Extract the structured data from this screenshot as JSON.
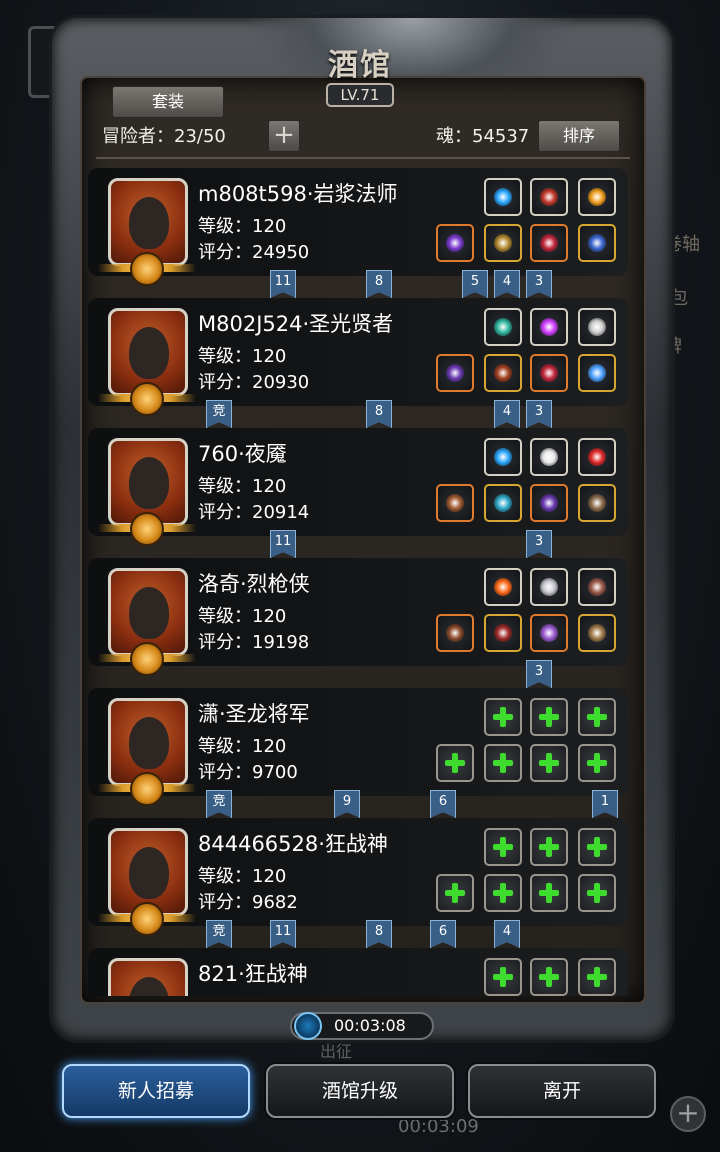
{
  "window": {
    "title": "酒馆",
    "level": "LV.71"
  },
  "toolbar": {
    "set_tab": "套装",
    "adventurers_label": "冒险者：23/50",
    "soul_label": "魂：54537",
    "sort_label": "排序",
    "add_label": "+"
  },
  "side_labels": [
    "卷轴",
    "包",
    "牌"
  ],
  "heroes": [
    {
      "name": "m808t598·岩浆法师",
      "level": "等级：120",
      "score": "评分：24950",
      "equip_top": [
        "blue-orb-icon",
        "red-horn-icon",
        "lantern-icon"
      ],
      "equip_bottom": [
        "purple-staff-icon",
        "gold-armor-icon",
        "red-amulet-icon",
        "blue-amulet-icon"
      ],
      "tags": [
        "11",
        "8",
        "5",
        "4",
        "3"
      ]
    },
    {
      "name": "M802J524·圣光贤者",
      "level": "等级：120",
      "score": "评分：20930",
      "equip_top": [
        "green-orb-icon",
        "purple-gem-icon",
        "wand-icon"
      ],
      "equip_bottom": [
        "staff-icon",
        "dark-armor-icon",
        "red-amulet-icon",
        "pendant-icon"
      ],
      "tags": [
        "竞",
        "8",
        "4",
        "3"
      ]
    },
    {
      "name": "760·夜魇",
      "level": "等级：120",
      "score": "评分：20914",
      "equip_top": [
        "blue-orb-icon",
        "white-horn-icon",
        "red-gem-icon"
      ],
      "equip_bottom": [
        "sword-icon",
        "cyan-armor-icon",
        "purple-ring-icon",
        "glove-icon"
      ],
      "tags": [
        "11",
        "3"
      ]
    },
    {
      "name": "洛奇·烈枪侠",
      "level": "等级：120",
      "score": "评分：19198",
      "equip_top": [
        "fire-orb-icon",
        "silver-cross-icon",
        "feather-icon"
      ],
      "equip_bottom": [
        "spear-icon",
        "red-armor-icon",
        "purple-crystal-icon",
        "bronze-helm-icon"
      ],
      "tags": [
        "3"
      ]
    },
    {
      "name": "潇·圣龙将军",
      "level": "等级：120",
      "score": "评分：9700",
      "equip_top": [
        "empty",
        "empty",
        "empty"
      ],
      "equip_bottom": [
        "empty",
        "empty",
        "empty",
        "empty"
      ],
      "tags": [
        "竞",
        "9",
        "6",
        "1"
      ]
    },
    {
      "name": "844466528·狂战神",
      "level": "等级：120",
      "score": "评分：9682",
      "equip_top": [
        "empty",
        "empty",
        "empty"
      ],
      "equip_bottom": [
        "empty",
        "empty",
        "empty",
        "empty"
      ],
      "tags": [
        "竞",
        "11",
        "8",
        "6",
        "4"
      ]
    },
    {
      "name": "821·狂战神",
      "level": "",
      "score": "",
      "equip_top": [
        "empty",
        "empty",
        "empty"
      ],
      "equip_bottom": [],
      "tags": []
    }
  ],
  "timer": "00:03:08",
  "background": {
    "label": "出征",
    "timer": "00:03:09"
  },
  "buttons": {
    "recruit": "新人招募",
    "upgrade": "酒馆升级",
    "leave": "离开"
  },
  "colors": {
    "panel": "#26221e",
    "accent_blue": "#2b5f9b",
    "tag_blue": "#3a5f86",
    "plus_green": "#3ddc2f",
    "gold_border": "#d8a733"
  }
}
